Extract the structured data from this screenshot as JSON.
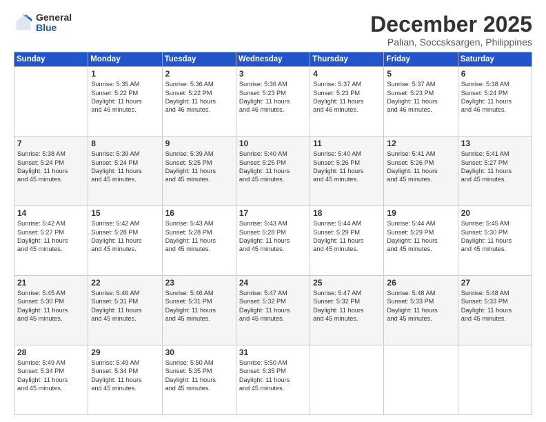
{
  "logo": {
    "general": "General",
    "blue": "Blue"
  },
  "title": "December 2025",
  "location": "Palian, Soccsksargen, Philippines",
  "days_header": [
    "Sunday",
    "Monday",
    "Tuesday",
    "Wednesday",
    "Thursday",
    "Friday",
    "Saturday"
  ],
  "weeks": [
    [
      {
        "num": "",
        "info": ""
      },
      {
        "num": "1",
        "info": "Sunrise: 5:35 AM\nSunset: 5:22 PM\nDaylight: 11 hours\nand 46 minutes."
      },
      {
        "num": "2",
        "info": "Sunrise: 5:36 AM\nSunset: 5:22 PM\nDaylight: 11 hours\nand 46 minutes."
      },
      {
        "num": "3",
        "info": "Sunrise: 5:36 AM\nSunset: 5:23 PM\nDaylight: 11 hours\nand 46 minutes."
      },
      {
        "num": "4",
        "info": "Sunrise: 5:37 AM\nSunset: 5:23 PM\nDaylight: 11 hours\nand 46 minutes."
      },
      {
        "num": "5",
        "info": "Sunrise: 5:37 AM\nSunset: 5:23 PM\nDaylight: 11 hours\nand 46 minutes."
      },
      {
        "num": "6",
        "info": "Sunrise: 5:38 AM\nSunset: 5:24 PM\nDaylight: 11 hours\nand 46 minutes."
      }
    ],
    [
      {
        "num": "7",
        "info": "Sunrise: 5:38 AM\nSunset: 5:24 PM\nDaylight: 11 hours\nand 45 minutes."
      },
      {
        "num": "8",
        "info": "Sunrise: 5:39 AM\nSunset: 5:24 PM\nDaylight: 11 hours\nand 45 minutes."
      },
      {
        "num": "9",
        "info": "Sunrise: 5:39 AM\nSunset: 5:25 PM\nDaylight: 11 hours\nand 45 minutes."
      },
      {
        "num": "10",
        "info": "Sunrise: 5:40 AM\nSunset: 5:25 PM\nDaylight: 11 hours\nand 45 minutes."
      },
      {
        "num": "11",
        "info": "Sunrise: 5:40 AM\nSunset: 5:26 PM\nDaylight: 11 hours\nand 45 minutes."
      },
      {
        "num": "12",
        "info": "Sunrise: 5:41 AM\nSunset: 5:26 PM\nDaylight: 11 hours\nand 45 minutes."
      },
      {
        "num": "13",
        "info": "Sunrise: 5:41 AM\nSunset: 5:27 PM\nDaylight: 11 hours\nand 45 minutes."
      }
    ],
    [
      {
        "num": "14",
        "info": "Sunrise: 5:42 AM\nSunset: 5:27 PM\nDaylight: 11 hours\nand 45 minutes."
      },
      {
        "num": "15",
        "info": "Sunrise: 5:42 AM\nSunset: 5:28 PM\nDaylight: 11 hours\nand 45 minutes."
      },
      {
        "num": "16",
        "info": "Sunrise: 5:43 AM\nSunset: 5:28 PM\nDaylight: 11 hours\nand 45 minutes."
      },
      {
        "num": "17",
        "info": "Sunrise: 5:43 AM\nSunset: 5:28 PM\nDaylight: 11 hours\nand 45 minutes."
      },
      {
        "num": "18",
        "info": "Sunrise: 5:44 AM\nSunset: 5:29 PM\nDaylight: 11 hours\nand 45 minutes."
      },
      {
        "num": "19",
        "info": "Sunrise: 5:44 AM\nSunset: 5:29 PM\nDaylight: 11 hours\nand 45 minutes."
      },
      {
        "num": "20",
        "info": "Sunrise: 5:45 AM\nSunset: 5:30 PM\nDaylight: 11 hours\nand 45 minutes."
      }
    ],
    [
      {
        "num": "21",
        "info": "Sunrise: 5:45 AM\nSunset: 5:30 PM\nDaylight: 11 hours\nand 45 minutes."
      },
      {
        "num": "22",
        "info": "Sunrise: 5:46 AM\nSunset: 5:31 PM\nDaylight: 11 hours\nand 45 minutes."
      },
      {
        "num": "23",
        "info": "Sunrise: 5:46 AM\nSunset: 5:31 PM\nDaylight: 11 hours\nand 45 minutes."
      },
      {
        "num": "24",
        "info": "Sunrise: 5:47 AM\nSunset: 5:32 PM\nDaylight: 11 hours\nand 45 minutes."
      },
      {
        "num": "25",
        "info": "Sunrise: 5:47 AM\nSunset: 5:32 PM\nDaylight: 11 hours\nand 45 minutes."
      },
      {
        "num": "26",
        "info": "Sunrise: 5:48 AM\nSunset: 5:33 PM\nDaylight: 11 hours\nand 45 minutes."
      },
      {
        "num": "27",
        "info": "Sunrise: 5:48 AM\nSunset: 5:33 PM\nDaylight: 11 hours\nand 45 minutes."
      }
    ],
    [
      {
        "num": "28",
        "info": "Sunrise: 5:49 AM\nSunset: 5:34 PM\nDaylight: 11 hours\nand 45 minutes."
      },
      {
        "num": "29",
        "info": "Sunrise: 5:49 AM\nSunset: 5:34 PM\nDaylight: 11 hours\nand 45 minutes."
      },
      {
        "num": "30",
        "info": "Sunrise: 5:50 AM\nSunset: 5:35 PM\nDaylight: 11 hours\nand 45 minutes."
      },
      {
        "num": "31",
        "info": "Sunrise: 5:50 AM\nSunset: 5:35 PM\nDaylight: 11 hours\nand 45 minutes."
      },
      {
        "num": "",
        "info": ""
      },
      {
        "num": "",
        "info": ""
      },
      {
        "num": "",
        "info": ""
      }
    ]
  ]
}
